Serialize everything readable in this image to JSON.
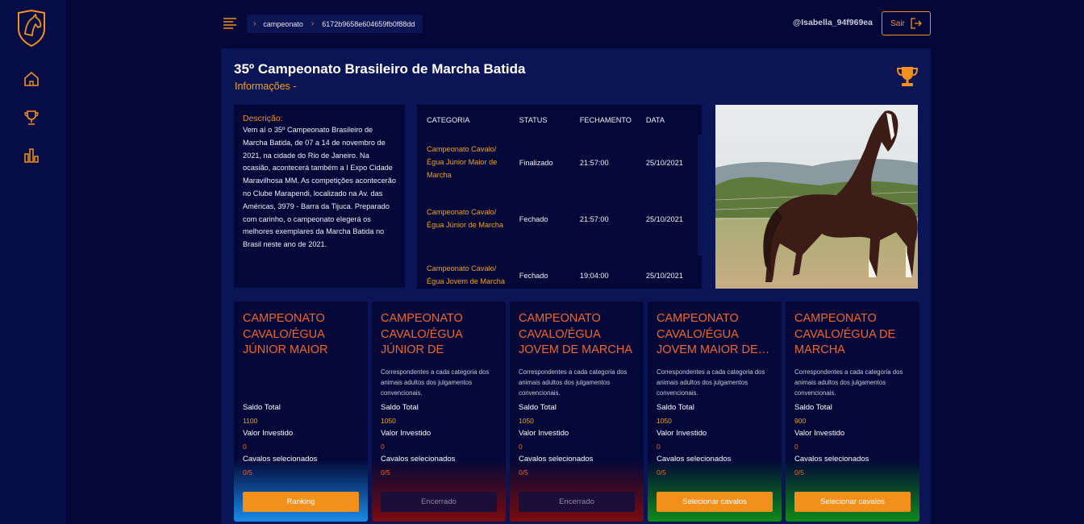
{
  "breadcrumb": {
    "root": "campeonato",
    "id": "6172b9658e604659fb0f88dd"
  },
  "user": {
    "name": "@Isabella_94f969ea",
    "logout_label": "Sair"
  },
  "championship": {
    "title": "35º Campeonato Brasileiro de Marcha Batida",
    "subtitle": "Informações -",
    "description_label": "Descrição:",
    "description": "Vem aí o 35º Campeonato Brasileiro de Marcha Batida, de 07 a 14 de novembro de 2021, na cidade do Rio de Janeiro. Na ocasião, acontecerá também a I Expo Cidade Maravilhosa MM. As competições acontecerão no Clube Marapendi, localizado na Av. das Américas, 3979 - Barra da Tijuca. Preparado com carinho, o campeonato elegerá os melhores exemplares da Marcha Batida no Brasil neste ano de 2021."
  },
  "table": {
    "headers": [
      "CATEGORIA",
      "STATUS",
      "FECHAMENTO",
      "DATA"
    ],
    "rows": [
      [
        "Campeonato Cavalo/ Égua Júnior Maior de Marcha",
        "Finalizado",
        "21:57:00",
        "25/10/2021"
      ],
      [
        "Campeonato Cavalo/ Égua Júnior de Marcha",
        "Fechado",
        "21:57:00",
        "25/10/2021"
      ],
      [
        "Campeonato Cavalo/ Égua Jovem de Marcha",
        "Fechado",
        "19:04:00",
        "25/10/2021"
      ]
    ]
  },
  "labels": {
    "saldo": "Saldo Total",
    "investido": "Valor Investido",
    "cavalos": "Cavalos selecionados"
  },
  "cards": [
    {
      "title": "CAMPEONATO CAVALO/ÉGUA JÚNIOR MAIOR DE…",
      "desc": "",
      "saldo": "1100",
      "investido": "0",
      "cavalos": "0/5",
      "button": "Ranking",
      "color": "#1a8be8"
    },
    {
      "title": "CAMPEONATO CAVALO/ÉGUA JÚNIOR DE MARCHA",
      "desc": "Correspondentes a cada categoria dos animais adultos dos julgamentos convencionais.",
      "saldo": "1050",
      "investido": "0",
      "cavalos": "0/5",
      "button": "Encerrado",
      "color": "#7a0b10"
    },
    {
      "title": "CAMPEONATO CAVALO/ÉGUA JOVEM DE MARCHA",
      "desc": "Correspondentes a cada categoria dos animais adultos dos julgamentos convencionais.",
      "saldo": "1050",
      "investido": "0",
      "cavalos": "0/5",
      "button": "Encerrado",
      "color": "#7a0b10"
    },
    {
      "title": "CAMPEONATO CAVALO/ÉGUA JOVEM MAIOR DE…",
      "desc": "Correspondentes a cada categoria dos animais adultos dos julgamentos convencionais.",
      "saldo": "1050",
      "investido": "0",
      "cavalos": "0/5",
      "button": "Selecionar cavalos",
      "color": "#0f8a1a"
    },
    {
      "title": "CAMPEONATO CAVALO/ÉGUA DE MARCHA",
      "desc": "Correspondentes a cada categoria dos animais adultos dos julgamentos convencionais.",
      "saldo": "900",
      "investido": "0",
      "cavalos": "0/5",
      "button": "Selecionar cavalos",
      "color": "#0f8a1a"
    }
  ],
  "colors": {
    "accent": "#f2901c",
    "background": "#030838",
    "panel": "#0b1556"
  }
}
